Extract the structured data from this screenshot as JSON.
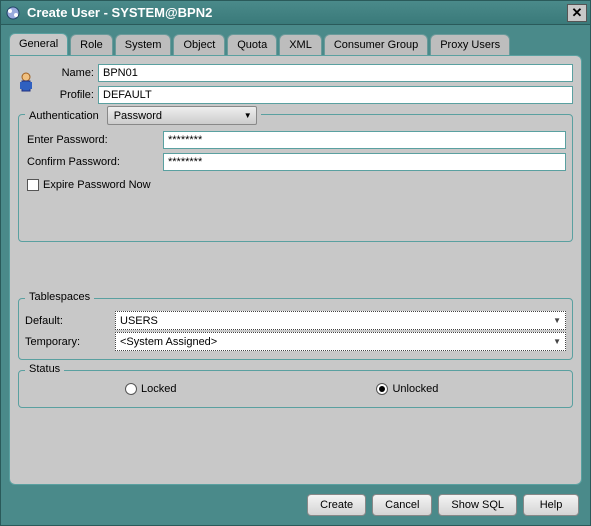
{
  "window": {
    "title": "Create User - SYSTEM@BPN2"
  },
  "tabs": [
    {
      "label": "General",
      "active": true
    },
    {
      "label": "Role"
    },
    {
      "label": "System"
    },
    {
      "label": "Object"
    },
    {
      "label": "Quota"
    },
    {
      "label": "XML"
    },
    {
      "label": "Consumer Group"
    },
    {
      "label": "Proxy Users"
    }
  ],
  "general": {
    "name_label": "Name:",
    "name_value": "BPN01",
    "profile_label": "Profile:",
    "profile_value": "DEFAULT"
  },
  "auth": {
    "legend": "Authentication",
    "method": "Password",
    "enter_pw_label": "Enter Password:",
    "enter_pw_value": "********",
    "confirm_pw_label": "Confirm Password:",
    "confirm_pw_value": "********",
    "expire_label": "Expire Password Now",
    "expire_checked": false
  },
  "tablespaces": {
    "legend": "Tablespaces",
    "default_label": "Default:",
    "default_value": "USERS",
    "temporary_label": "Temporary:",
    "temporary_value": "<System Assigned>"
  },
  "status": {
    "legend": "Status",
    "locked_label": "Locked",
    "unlocked_label": "Unlocked",
    "selected": "unlocked"
  },
  "buttons": {
    "create": "Create",
    "cancel": "Cancel",
    "show_sql": "Show SQL",
    "help": "Help"
  }
}
